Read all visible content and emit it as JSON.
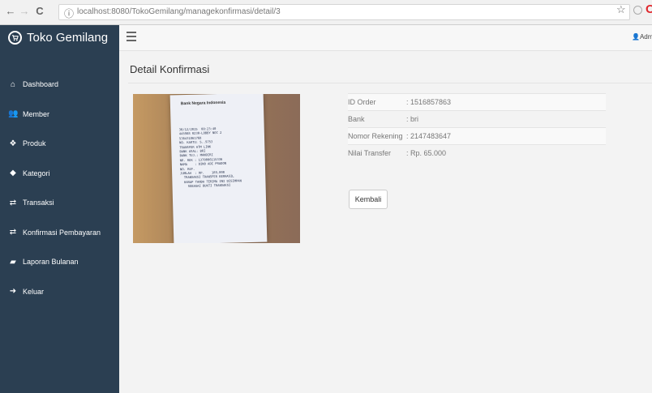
{
  "browser": {
    "back": "←",
    "forward": "→",
    "reload": "C",
    "info": "ⓘ",
    "url": "localhost:8080/TokoGemilang/managekonfirmasi/detail/3",
    "star": "☆",
    "opera": "O"
  },
  "brand": {
    "icon": "🛒",
    "name": "Toko Gemilang"
  },
  "sidebar": {
    "items": [
      {
        "icon": "home-icon",
        "glyph": "⌂",
        "label": "Dashboard"
      },
      {
        "icon": "users-icon",
        "glyph": "👥",
        "label": "Member"
      },
      {
        "icon": "cubes-icon",
        "glyph": "❖",
        "label": "Produk"
      },
      {
        "icon": "tag-icon",
        "glyph": "◆",
        "label": "Kategori"
      },
      {
        "icon": "exchange-icon",
        "glyph": "⇄",
        "label": "Transaksi"
      },
      {
        "icon": "exchange-icon",
        "glyph": "⇄",
        "label": "Konfirmasi Pembayaran"
      },
      {
        "icon": "book-icon",
        "glyph": "▰",
        "label": "Laporan Bulanan"
      },
      {
        "icon": "sign-out-icon",
        "glyph": "➜",
        "label": "Keluar"
      }
    ]
  },
  "topbar": {
    "user_icon": "👤",
    "user": "Admin"
  },
  "page": {
    "title": "Detail Konfirmasi"
  },
  "receipt": {
    "logo": "Bank Negara Indonesia",
    "lines": "30/12/2015  08:23:40\n445988 0230-LOBBY NOC 2\n536431861768\nNO. KARTU: 5..9753\nTRANSFER ATM LINK\nBANK ASAL: BRI\nBANK TUJ.: MANDIRI\nNO. REK : 1370006115336\nNAMA    : DINO ADI PRADON\nNO. REF.\nJUMLAH  : RP.    189,000\n  TRANSAKSI TRANSFER BERHASIL\n  HARAP TANDA TERIMA INI DISIMPAN\n    SEBAGAI BUKTI TRANSAKSI"
  },
  "detail": {
    "rows": [
      {
        "label": "ID Order",
        "value": ": 1516857863"
      },
      {
        "label": "Bank",
        "value": ": bri"
      },
      {
        "label": "Nomor Rekening",
        "value": ": 2147483647"
      },
      {
        "label": "Nilai Transfer",
        "value": ": Rp. 65.000"
      }
    ]
  },
  "actions": {
    "back_label": "Kembali"
  }
}
